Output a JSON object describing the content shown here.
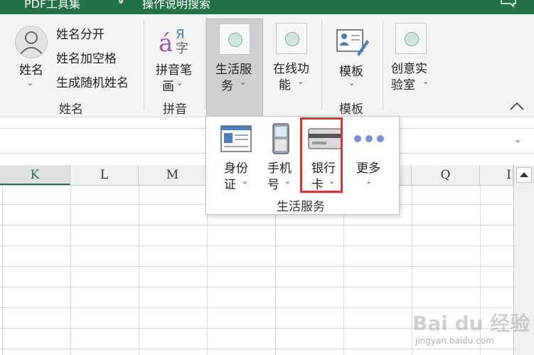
{
  "titlebar": {
    "left_text": "PDF工具集",
    "help_text": "操作说明搜索"
  },
  "ribbon": {
    "name_group": {
      "big_button": "姓名",
      "items": [
        "姓名分开",
        "姓名加空格",
        "生成随机姓名"
      ],
      "group_label": "姓名"
    },
    "pinyin_group": {
      "button_line1": "拼音笔",
      "button_line2": "画",
      "group_label": "拼音"
    },
    "life_service": {
      "line1": "生活服",
      "line2": "务"
    },
    "online": {
      "line1": "在线功",
      "line2": "能"
    },
    "template": {
      "label": "模板",
      "group_label": "模板"
    },
    "lab": {
      "line1": "创意实",
      "line2": "验室"
    },
    "collapse_icon": "chevron-up-icon",
    "caret": "⌄"
  },
  "dropdown": {
    "items": [
      {
        "line1": "身份",
        "line2": "证",
        "icon": "id-card-icon"
      },
      {
        "line1": "手机",
        "line2": "号",
        "icon": "mobile-phone-icon"
      },
      {
        "line1": "银行",
        "line2": "卡",
        "icon": "bank-card-icon"
      },
      {
        "line1": "更多",
        "line2": "",
        "icon": "more-dots-icon"
      }
    ],
    "group_label": "生活服务",
    "highlight_color": "#e0312a"
  },
  "sheet": {
    "columns": [
      "K",
      "L",
      "M",
      "Q"
    ],
    "partial_column": "I"
  },
  "watermark": {
    "text": "Bai du 经验",
    "url": "jingyan.baidu.com"
  },
  "colors": {
    "accent": "#217346",
    "ribbon_bg": "#f3f3f3"
  }
}
